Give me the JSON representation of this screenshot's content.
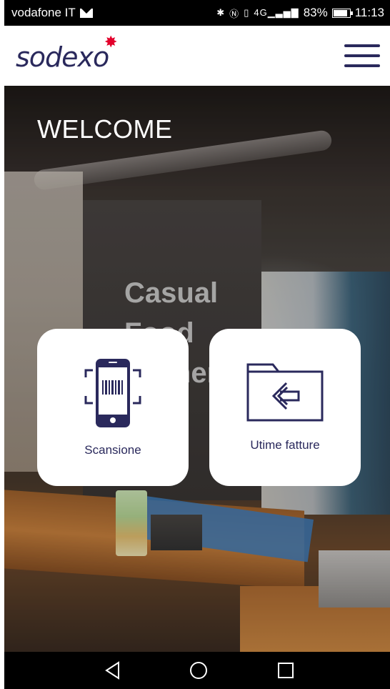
{
  "status_bar": {
    "carrier": "vodafone IT",
    "signal_text": "4G",
    "battery_percent": "83%",
    "time": "11:13",
    "icons": [
      "mail-icon",
      "bluetooth-icon",
      "nfc-icon",
      "vibrate-icon",
      "signal-icon",
      "battery-icon"
    ]
  },
  "header": {
    "logo_text": "sodexo",
    "brand_colors": {
      "primary": "#2a295c",
      "accent": "#e3002b"
    },
    "menu_icon": "hamburger-menu-icon"
  },
  "hero": {
    "welcome": "WELCOME",
    "background_sign": [
      "Casual",
      "Food",
      "Corner"
    ],
    "tiles": [
      {
        "label": "Scansione",
        "icon": "phone-barcode-scan-icon"
      },
      {
        "label": "Utime fatture",
        "icon": "folder-arrow-left-icon"
      }
    ]
  },
  "nav_bar": {
    "icons": [
      "back-icon",
      "home-icon",
      "recents-icon"
    ]
  }
}
